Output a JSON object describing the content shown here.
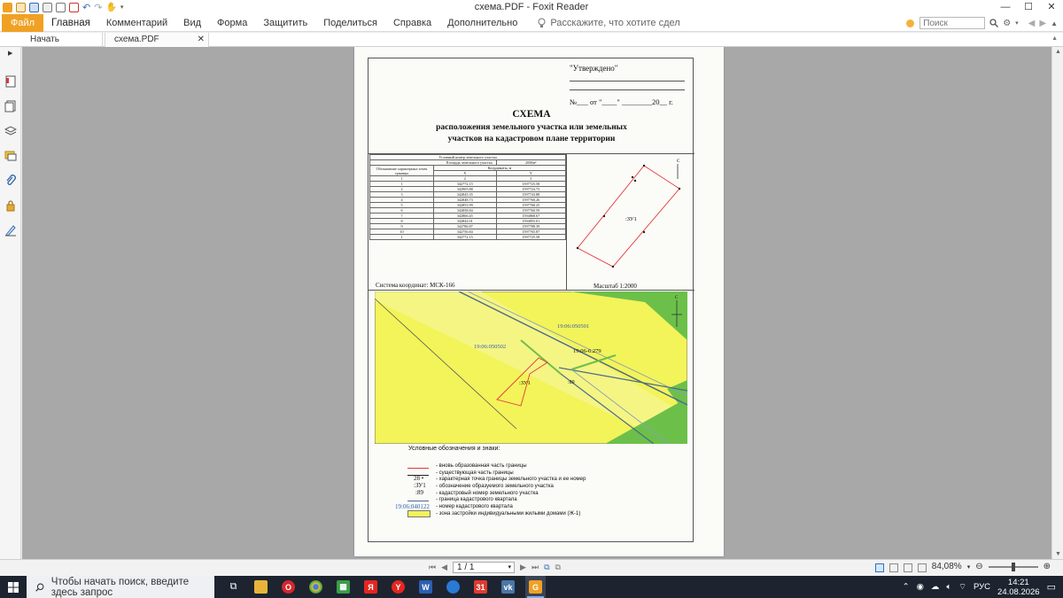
{
  "app": {
    "title": "схема.PDF - Foxit Reader"
  },
  "menu": {
    "file": "Файл",
    "items": [
      "Главная",
      "Комментарий",
      "Вид",
      "Форма",
      "Защитить",
      "Поделиться",
      "Справка",
      "Дополнительно"
    ],
    "tell_me": "Расскажите, что хотите сдел",
    "search_placeholder": "Поиск"
  },
  "tabs": [
    {
      "label": "Начать"
    },
    {
      "label": "схема.PDF"
    }
  ],
  "document": {
    "approved": "\"Утверждено\"",
    "approval_date": "№___ от \"____\" ________20__ г.",
    "title": "СХЕМА",
    "subtitle_1": "расположения земельного участка или земельных",
    "subtitle_2": "участков на кадастровом плане территории",
    "table": {
      "header_1": "Условный номер земельного участка",
      "header_area_label": "Площадь земельного участка",
      "header_area_value": "2000м²",
      "col_point": "Обозначение характерных точек границы",
      "col_coords": "Координаты, м",
      "col_x": "X",
      "col_y": "Y",
      "col_nums": [
        "1",
        "2",
        "3"
      ],
      "rows": [
        [
          "1",
          "342772.15",
          "1597725.58"
        ],
        [
          "2",
          "342905.88",
          "1597724.73"
        ],
        [
          "3",
          "342845.35",
          "1597743.88"
        ],
        [
          "4",
          "342848.73",
          "1597760.26"
        ],
        [
          "5",
          "342853.99",
          "1597768.25"
        ],
        [
          "6",
          "342858.84",
          "1597760.59"
        ],
        [
          "7",
          "342866.45",
          "1594868.67"
        ],
        [
          "8",
          "342842.01",
          "1594855.01"
        ],
        [
          "9",
          "342786.87",
          "1597788.39"
        ],
        [
          "10",
          "342756.84",
          "1597765.87"
        ],
        [
          "1",
          "342772.15",
          "1597725.58"
        ]
      ]
    },
    "coord_system": "Система координат: МСК-166",
    "scale": "Масштаб 1:2000",
    "north": "С",
    "plot_label": ":ЗУ1",
    "map": {
      "quarter_1": "19:06:050501",
      "quarter_2": "19:06:050502",
      "quarter_3": "19:06-6.279",
      "plot": ":ЗУ1",
      "point": ":89",
      "north": "С"
    },
    "legend": {
      "title": "Условные обозначения и знаки:",
      "items": [
        {
          "symbol": "",
          "text": "- вновь образованная часть границы"
        },
        {
          "symbol": "",
          "text": "- существующая часть границы"
        },
        {
          "symbol": "28 •",
          "text": "- характерная точка границы земельного участка и ее номер"
        },
        {
          "symbol": ":ЗУ1",
          "text": "- обозначение образуемого земельного участка"
        },
        {
          "symbol": ":89",
          "text": "- кадастровый номер земельного участка"
        },
        {
          "symbol": "",
          "text": "- граница кадастрового квартала"
        },
        {
          "symbol": "19:06:040122",
          "text": "- номер кадастрового квартала"
        },
        {
          "symbol": "",
          "text": "- зона застройки индивидуальными жилыми домами (Ж-1)"
        }
      ]
    }
  },
  "status": {
    "page": "1 / 1",
    "zoom": "84,08%"
  },
  "taskbar": {
    "search_placeholder": "Чтобы начать поиск, введите здесь запрос",
    "lang": "РУС",
    "time": "14:21",
    "date": "24.08.2026"
  },
  "colors": {
    "accent": "#f0a124",
    "map_yellow": "#f3f35a",
    "map_green": "#6cc04a",
    "boundary_red": "#e23a3a",
    "taskbar": "#1d2430"
  }
}
